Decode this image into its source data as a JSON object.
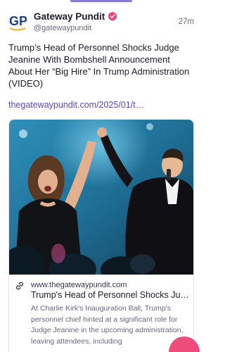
{
  "post": {
    "author": {
      "display_name": "Gateway Pundit",
      "handle": "@gatewaypundit",
      "avatar_text": "GP",
      "avatar_color": "#1a3f8f",
      "verified_color": "#e8457a"
    },
    "timestamp": "27m",
    "text": "Trump’s Head of Personnel Shocks Judge Jeanine With Bombshell Announcement About Her “Big Hire” In Trump Administration (VIDEO)",
    "link": "thegatewaypundit.com/2025/01/t…",
    "card": {
      "domain": "www.thegatewaypundit.com",
      "title": "Trump's Head of Personnel Shocks Ju…",
      "description": "At Charlie Kirk's Inauguration Ball, Trump's personnel chief hinted at a significant role for Judge Jeanine in the upcoming administration, leaving attendees, including"
    }
  },
  "colors": {
    "accent": "#5b48c8",
    "text": "#1f1a2e",
    "muted": "#6b6680",
    "fab": "#ee4d7a"
  },
  "icons": {
    "verified": "verified-badge-icon",
    "link": "link-icon"
  }
}
